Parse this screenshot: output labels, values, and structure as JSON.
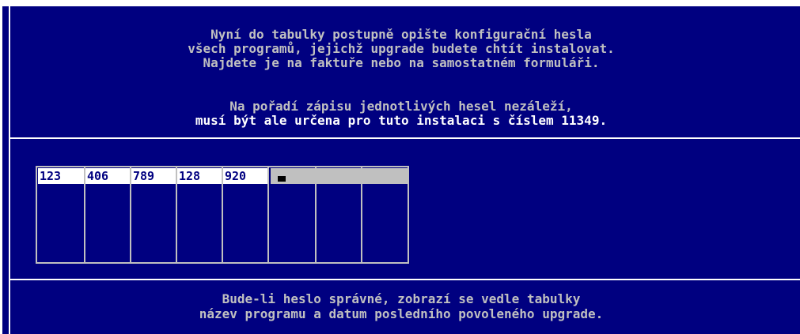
{
  "instructions": {
    "line1": "Nyní do tabulky postupně opište konfigurační hesla",
    "line2": "všech programů, jejichž upgrade budete chtít instalovat.",
    "line3": "Najdete je na faktuře nebo na samostatném formuláři.",
    "line4": "Na pořadí zápisu jednotlivých hesel nezáleží,",
    "line5": "musí být ale určena pro tuto instalaci s číslem 11349."
  },
  "table": {
    "cells": [
      "123",
      "406",
      "789",
      "128",
      "920",
      "",
      "",
      ""
    ]
  },
  "footer": {
    "line1": "Bude-li heslo správné, zobrazí se vedle tabulky",
    "line2": "název programu a datum posledního povoleného upgrade."
  },
  "colors": {
    "background": "#000080",
    "text": "#c0c0c0",
    "highlight": "#ffffff",
    "cell_filled": "#ffffff",
    "cell_empty": "#c0c0c0"
  }
}
